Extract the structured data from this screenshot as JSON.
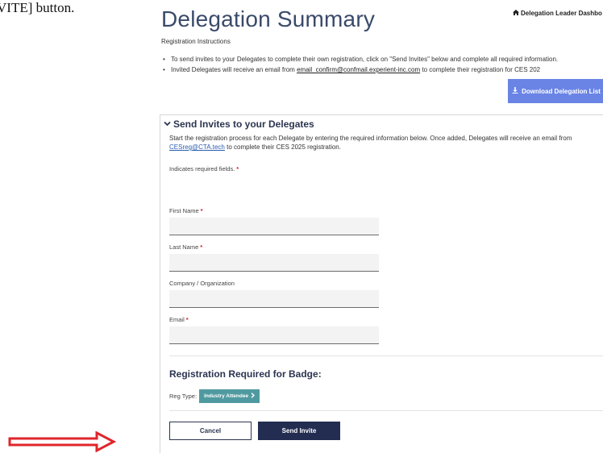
{
  "doc_text": "VITE] button.",
  "page": {
    "title": "Delegation Summary",
    "breadcrumb": "Delegation Leader Dashbo"
  },
  "instructions": {
    "heading": "Registration Instructions",
    "bullet1": "To send invites to your Delegates to complete their own registration, click on \"Send Invites\" below and complete all required information.",
    "bullet2_pre": "Invited Delegates will receive an email from ",
    "bullet2_link": "email_confirm@confmail.experient-inc.com",
    "bullet2_post": " to complete their registration for CES 202"
  },
  "download_button": {
    "label": "Download Delegation List"
  },
  "invite_panel": {
    "title": "Send Invites to your Delegates",
    "desc_pre": "Start the registration process for each Delegate by entering the required information below. Once added, Delegates will receive an email from ",
    "desc_link": "CESreg@CTA.tech",
    "desc_post": " to complete their CES 2025 registration.",
    "required_note": "Indicates required fields.",
    "required_star": "*"
  },
  "fields": {
    "first_name": {
      "label": "First Name",
      "value": ""
    },
    "last_name": {
      "label": "Last Name",
      "value": ""
    },
    "company": {
      "label": "Company / Organization",
      "value": ""
    },
    "email": {
      "label": "Email",
      "value": ""
    }
  },
  "badge": {
    "title": "Registration Required for Badge:",
    "reg_type_label": "Reg Type:",
    "reg_type_value": "Industry Attendee"
  },
  "actions": {
    "cancel": "Cancel",
    "send": "Send Invite"
  },
  "colors": {
    "title": "#3a4a6b",
    "download_btn": "#6a84e6",
    "reg_type_btn": "#4f9aa0",
    "send_btn": "#232d52",
    "required_star": "#d11f2c",
    "arrow": "#e0262b"
  }
}
